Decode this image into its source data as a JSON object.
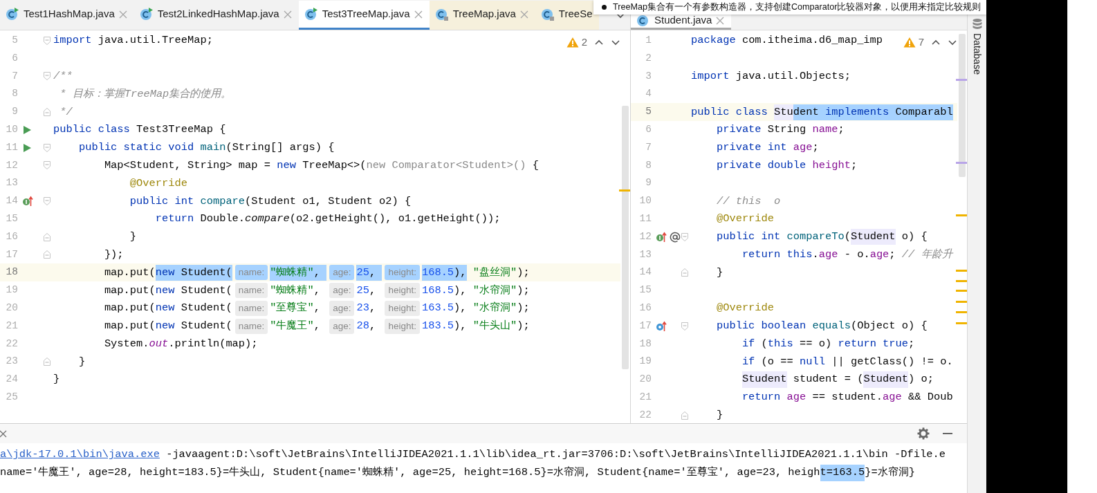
{
  "tooltip": {
    "text": "TreeMap集合有一个有参数构造器，支持创建Comparator比较器对象，以便用来指定比较规则"
  },
  "editors": [
    {
      "focused": true,
      "overflow_menu": true,
      "warnings": {
        "count": "2"
      },
      "tabs": [
        {
          "label": "Test1HashMap.java",
          "kind": "runnable",
          "selected": false,
          "closable": true
        },
        {
          "label": "Test2LinkedHashMap.java",
          "kind": "runnable",
          "selected": false,
          "closable": true
        },
        {
          "label": "Test3TreeMap.java",
          "kind": "runnable",
          "selected": true,
          "closable": true
        },
        {
          "label": "TreeMap.java",
          "kind": "library",
          "selected": false,
          "closable": true
        },
        {
          "label": "TreeSe",
          "kind": "library",
          "selected": false,
          "closable": false
        }
      ],
      "lines": [
        {
          "number": "5",
          "fold_start": true,
          "tokens": [
            {
              "text": "import",
              "kind": "keyword"
            },
            {
              "text": " java.util.TreeMap;",
              "kind": "plain"
            }
          ]
        },
        {
          "number": "6"
        },
        {
          "number": "7",
          "fold_start": true,
          "tokens": [
            {
              "text": "/**",
              "kind": "comment"
            }
          ]
        },
        {
          "number": "8",
          "tokens": [
            {
              "text": " * 目标：掌握TreeMap集合的使用。",
              "kind": "comment"
            }
          ]
        },
        {
          "number": "9",
          "fold_end": true,
          "tokens": [
            {
              "text": " */",
              "kind": "comment"
            }
          ]
        },
        {
          "number": "10",
          "markers": [
            {
              "kind": "run"
            }
          ],
          "tokens": [
            {
              "text": "public class",
              "kind": "keyword"
            },
            {
              "text": " Test3TreeMap {",
              "kind": "plain"
            }
          ]
        },
        {
          "number": "11",
          "markers": [
            {
              "kind": "run"
            }
          ],
          "fold_start": true,
          "tokens": [
            {
              "text": "    public static void ",
              "kind": "keyword"
            },
            {
              "text": "main",
              "kind": "method"
            },
            {
              "text": "(String[] args) {",
              "kind": "plain"
            }
          ]
        },
        {
          "number": "12",
          "fold_start": true,
          "tokens": [
            {
              "text": "        Map<Student, String> map = ",
              "kind": "plain"
            },
            {
              "text": "new",
              "kind": "keyword"
            },
            {
              "text": " TreeMap<>(",
              "kind": "plain"
            },
            {
              "text": "new Comparator<Student>() ",
              "kind": "muted"
            },
            {
              "text": "{",
              "kind": "plain"
            }
          ]
        },
        {
          "number": "13",
          "tokens": [
            {
              "text": "            @Override",
              "kind": "annotation"
            }
          ]
        },
        {
          "number": "14",
          "markers": [
            {
              "kind": "implements"
            }
          ],
          "fold_start": true,
          "tokens": [
            {
              "text": "            public int ",
              "kind": "keyword"
            },
            {
              "text": "compare",
              "kind": "method"
            },
            {
              "text": "(Student o1, Student o2) {",
              "kind": "plain"
            }
          ]
        },
        {
          "number": "15",
          "tokens": [
            {
              "text": "                return",
              "kind": "keyword"
            },
            {
              "text": " Double.",
              "kind": "plain"
            },
            {
              "text": "compare",
              "kind": "italic"
            },
            {
              "text": "(o2.getHeight(), o1.getHeight());",
              "kind": "plain"
            }
          ]
        },
        {
          "number": "16",
          "fold_end": true,
          "tokens": [
            {
              "text": "            }",
              "kind": "plain"
            }
          ]
        },
        {
          "number": "17",
          "fold_end": true,
          "tokens": [
            {
              "text": "        });",
              "kind": "plain"
            }
          ]
        },
        {
          "number": "18",
          "current": true,
          "tokens": [
            {
              "text": "        map.put(",
              "kind": "plain"
            },
            {
              "text": "new",
              "kind": "keyword",
              "selected": true
            },
            {
              "text": " Student(",
              "kind": "plain",
              "selected": true
            },
            {
              "text": "name:",
              "kind": "hint",
              "selected": true
            },
            {
              "text": "\"蜘蛛精\"",
              "kind": "string",
              "selected": true
            },
            {
              "text": ", ",
              "kind": "plain",
              "selected": true
            },
            {
              "text": "age:",
              "kind": "hint",
              "selected": true
            },
            {
              "text": "25",
              "kind": "number",
              "selected": true
            },
            {
              "text": ", ",
              "kind": "plain",
              "selected": true
            },
            {
              "text": "height:",
              "kind": "hint",
              "selected": true
            },
            {
              "text": "168.5",
              "kind": "number",
              "selected": true
            },
            {
              "text": "),",
              "kind": "plain",
              "selected": true
            },
            {
              "text": " \"盘丝洞\"",
              "kind": "string"
            },
            {
              "text": ");",
              "kind": "plain"
            }
          ]
        },
        {
          "number": "19",
          "tokens": [
            {
              "text": "        map.put(",
              "kind": "plain"
            },
            {
              "text": "new",
              "kind": "keyword"
            },
            {
              "text": " Student(",
              "kind": "plain"
            },
            {
              "text": "name:",
              "kind": "hint"
            },
            {
              "text": "\"蜘蛛精\"",
              "kind": "string"
            },
            {
              "text": ", ",
              "kind": "plain"
            },
            {
              "text": "age:",
              "kind": "hint"
            },
            {
              "text": "25",
              "kind": "number"
            },
            {
              "text": ", ",
              "kind": "plain"
            },
            {
              "text": "height:",
              "kind": "hint"
            },
            {
              "text": "168.5",
              "kind": "number"
            },
            {
              "text": "), ",
              "kind": "plain"
            },
            {
              "text": "\"水帘洞\"",
              "kind": "string"
            },
            {
              "text": ");",
              "kind": "plain"
            }
          ]
        },
        {
          "number": "20",
          "tokens": [
            {
              "text": "        map.put(",
              "kind": "plain"
            },
            {
              "text": "new",
              "kind": "keyword"
            },
            {
              "text": " Student(",
              "kind": "plain"
            },
            {
              "text": "name:",
              "kind": "hint"
            },
            {
              "text": "\"至尊宝\"",
              "kind": "string"
            },
            {
              "text": ", ",
              "kind": "plain"
            },
            {
              "text": "age:",
              "kind": "hint"
            },
            {
              "text": "23",
              "kind": "number"
            },
            {
              "text": ", ",
              "kind": "plain"
            },
            {
              "text": "height:",
              "kind": "hint"
            },
            {
              "text": "163.5",
              "kind": "number"
            },
            {
              "text": "), ",
              "kind": "plain"
            },
            {
              "text": "\"水帘洞\"",
              "kind": "string"
            },
            {
              "text": ");",
              "kind": "plain"
            }
          ]
        },
        {
          "number": "21",
          "tokens": [
            {
              "text": "        map.put(",
              "kind": "plain"
            },
            {
              "text": "new",
              "kind": "keyword"
            },
            {
              "text": " Student(",
              "kind": "plain"
            },
            {
              "text": "name:",
              "kind": "hint"
            },
            {
              "text": "\"牛魔王\"",
              "kind": "string"
            },
            {
              "text": ", ",
              "kind": "plain"
            },
            {
              "text": "age:",
              "kind": "hint"
            },
            {
              "text": "28",
              "kind": "number"
            },
            {
              "text": ", ",
              "kind": "plain"
            },
            {
              "text": "height:",
              "kind": "hint"
            },
            {
              "text": "183.5",
              "kind": "number"
            },
            {
              "text": "), ",
              "kind": "plain"
            },
            {
              "text": "\"牛头山\"",
              "kind": "string"
            },
            {
              "text": ");",
              "kind": "plain"
            }
          ]
        },
        {
          "number": "22",
          "tokens": [
            {
              "text": "        System.",
              "kind": "plain"
            },
            {
              "text": "out",
              "kind": "static"
            },
            {
              "text": ".println(map);",
              "kind": "plain"
            }
          ]
        },
        {
          "number": "23",
          "fold_end": true,
          "tokens": [
            {
              "text": "    }",
              "kind": "plain"
            }
          ]
        },
        {
          "number": "24",
          "tokens": [
            {
              "text": "}",
              "kind": "plain"
            }
          ]
        },
        {
          "number": "25"
        }
      ]
    },
    {
      "focused": false,
      "warnings": {
        "count": "7"
      },
      "tabs": [
        {
          "label": "Student.java",
          "kind": "class",
          "selected": true,
          "closable": true
        }
      ],
      "lines": [
        {
          "number": "1",
          "tokens": [
            {
              "text": "package",
              "kind": "keyword"
            },
            {
              "text": " com.itheima.d6_map_imp",
              "kind": "plain"
            }
          ]
        },
        {
          "number": "2"
        },
        {
          "number": "3",
          "tokens": [
            {
              "text": "import",
              "kind": "keyword"
            },
            {
              "text": " java.util.Objects;",
              "kind": "plain"
            }
          ]
        },
        {
          "number": "4"
        },
        {
          "number": "5",
          "current": true,
          "tokens": [
            {
              "text": "public class ",
              "kind": "keyword"
            },
            {
              "text": "Stu",
              "kind": "usage"
            },
            {
              "text": "dent ",
              "kind": "plain",
              "selected": true
            },
            {
              "text": "implements",
              "kind": "keyword",
              "selected": true
            },
            {
              "text": " Comparabl",
              "kind": "plain",
              "selected": true
            }
          ]
        },
        {
          "number": "6",
          "tokens": [
            {
              "text": "    private",
              "kind": "keyword"
            },
            {
              "text": " String ",
              "kind": "plain"
            },
            {
              "text": "name",
              "kind": "field"
            },
            {
              "text": ";",
              "kind": "plain"
            }
          ]
        },
        {
          "number": "7",
          "tokens": [
            {
              "text": "    private int ",
              "kind": "keyword"
            },
            {
              "text": "age",
              "kind": "field"
            },
            {
              "text": ";",
              "kind": "plain"
            }
          ]
        },
        {
          "number": "8",
          "tokens": [
            {
              "text": "    private double ",
              "kind": "keyword"
            },
            {
              "text": "height",
              "kind": "field"
            },
            {
              "text": ";",
              "kind": "plain"
            }
          ]
        },
        {
          "number": "9"
        },
        {
          "number": "10",
          "tokens": [
            {
              "text": "    // this  o",
              "kind": "comment"
            }
          ]
        },
        {
          "number": "11",
          "tokens": [
            {
              "text": "    @Override",
              "kind": "annotation"
            }
          ]
        },
        {
          "number": "12",
          "markers": [
            {
              "kind": "implements"
            },
            {
              "kind": "annotation"
            }
          ],
          "fold_start": true,
          "tokens": [
            {
              "text": "    public int ",
              "kind": "keyword"
            },
            {
              "text": "compareTo",
              "kind": "method"
            },
            {
              "text": "(",
              "kind": "plain"
            },
            {
              "text": "Student",
              "kind": "usage"
            },
            {
              "text": " o) {",
              "kind": "plain"
            }
          ]
        },
        {
          "number": "13",
          "tokens": [
            {
              "text": "        return this",
              "kind": "keyword"
            },
            {
              "text": ".",
              "kind": "plain"
            },
            {
              "text": "age",
              "kind": "field"
            },
            {
              "text": " - o.",
              "kind": "plain"
            },
            {
              "text": "age",
              "kind": "field"
            },
            {
              "text": "; ",
              "kind": "plain"
            },
            {
              "text": "// 年龄升",
              "kind": "comment"
            }
          ]
        },
        {
          "number": "14",
          "fold_end": true,
          "tokens": [
            {
              "text": "    }",
              "kind": "plain"
            }
          ]
        },
        {
          "number": "15"
        },
        {
          "number": "16",
          "tokens": [
            {
              "text": "    @Override",
              "kind": "annotation"
            }
          ]
        },
        {
          "number": "17",
          "markers": [
            {
              "kind": "overrides"
            }
          ],
          "fold_start": true,
          "tokens": [
            {
              "text": "    public boolean ",
              "kind": "keyword"
            },
            {
              "text": "equals",
              "kind": "method"
            },
            {
              "text": "(Object o) {",
              "kind": "plain"
            }
          ]
        },
        {
          "number": "18",
          "tokens": [
            {
              "text": "        if",
              "kind": "keyword"
            },
            {
              "text": " (",
              "kind": "plain"
            },
            {
              "text": "this",
              "kind": "keyword"
            },
            {
              "text": " == o) ",
              "kind": "plain"
            },
            {
              "text": "return true",
              "kind": "keyword"
            },
            {
              "text": ";",
              "kind": "plain"
            }
          ]
        },
        {
          "number": "19",
          "tokens": [
            {
              "text": "        if",
              "kind": "keyword"
            },
            {
              "text": " (o == ",
              "kind": "plain"
            },
            {
              "text": "null",
              "kind": "keyword"
            },
            {
              "text": " || getClass() != o.",
              "kind": "plain"
            }
          ]
        },
        {
          "number": "20",
          "tokens": [
            {
              "text": "        Student",
              "kind": "usage"
            },
            {
              "text": " student = (",
              "kind": "plain"
            },
            {
              "text": "Student",
              "kind": "usage"
            },
            {
              "text": ") o;",
              "kind": "plain"
            }
          ]
        },
        {
          "number": "21",
          "tokens": [
            {
              "text": "        return ",
              "kind": "keyword"
            },
            {
              "text": "age",
              "kind": "field"
            },
            {
              "text": " == student.",
              "kind": "plain"
            },
            {
              "text": "age",
              "kind": "field"
            },
            {
              "text": " && Doub",
              "kind": "plain"
            }
          ]
        },
        {
          "number": "22",
          "fold_end": true,
          "tokens": [
            {
              "text": "    }",
              "kind": "plain"
            }
          ]
        }
      ]
    }
  ],
  "console": {
    "lines": [
      {
        "tokens": [
          {
            "text": "a\\jdk-17.0.1\\bin\\java.exe",
            "kind": "link"
          },
          {
            "text": " -javaagent:D:\\soft\\JetBrains\\IntelliJIDEA2021.1.1\\lib\\idea_rt.jar=3706:D:\\soft\\JetBrains\\IntelliJIDEA2021.1.1\\bin -Dfile.e",
            "kind": "plain"
          }
        ]
      },
      {
        "tokens": [
          {
            "text": "name='牛魔王', age=28, height=183.5}=牛头山, Student{name='蜘蛛精', age=25, height=168.5}=水帘洞, Student{name='至尊宝', age=23, heigh",
            "kind": "plain"
          },
          {
            "text": "t=163.5",
            "kind": "plain",
            "selected": true
          },
          {
            "text": "}=水帘洞}",
            "kind": "plain"
          }
        ]
      }
    ]
  },
  "tool_strip": {
    "label": "Database"
  }
}
